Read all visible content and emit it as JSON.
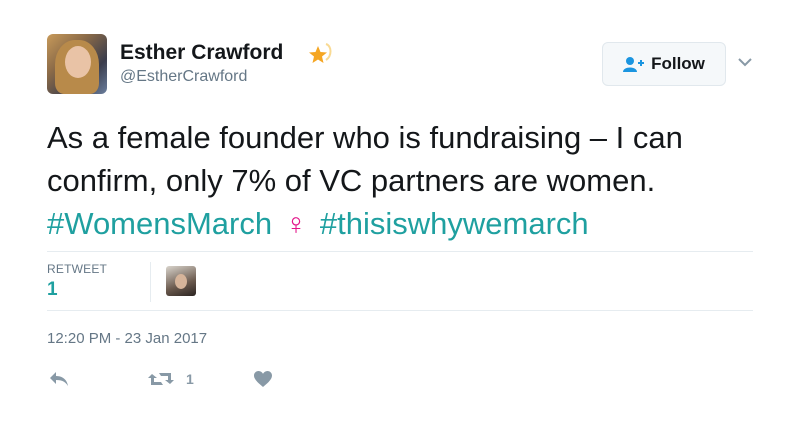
{
  "author": {
    "name": "Esther Crawford",
    "handle": "@EstherCrawford"
  },
  "follow_button": {
    "label": "Follow"
  },
  "tweet": {
    "line1": "As a female founder who is fundraising – I can",
    "line2": "confirm, only 7% of VC partners are women.",
    "hashtag1": "#WomensMarch",
    "emoji": "♀",
    "hashtag2": "#thisiswhywemarch"
  },
  "stats": {
    "retweet_label": "RETWEET",
    "retweet_count": "1"
  },
  "timestamp": "12:20 PM - 23 Jan 2017",
  "actions": {
    "retweet_count": "1"
  },
  "colors": {
    "accent": "#1fa0a0",
    "venus": "#e3168b",
    "muted": "#657786"
  }
}
